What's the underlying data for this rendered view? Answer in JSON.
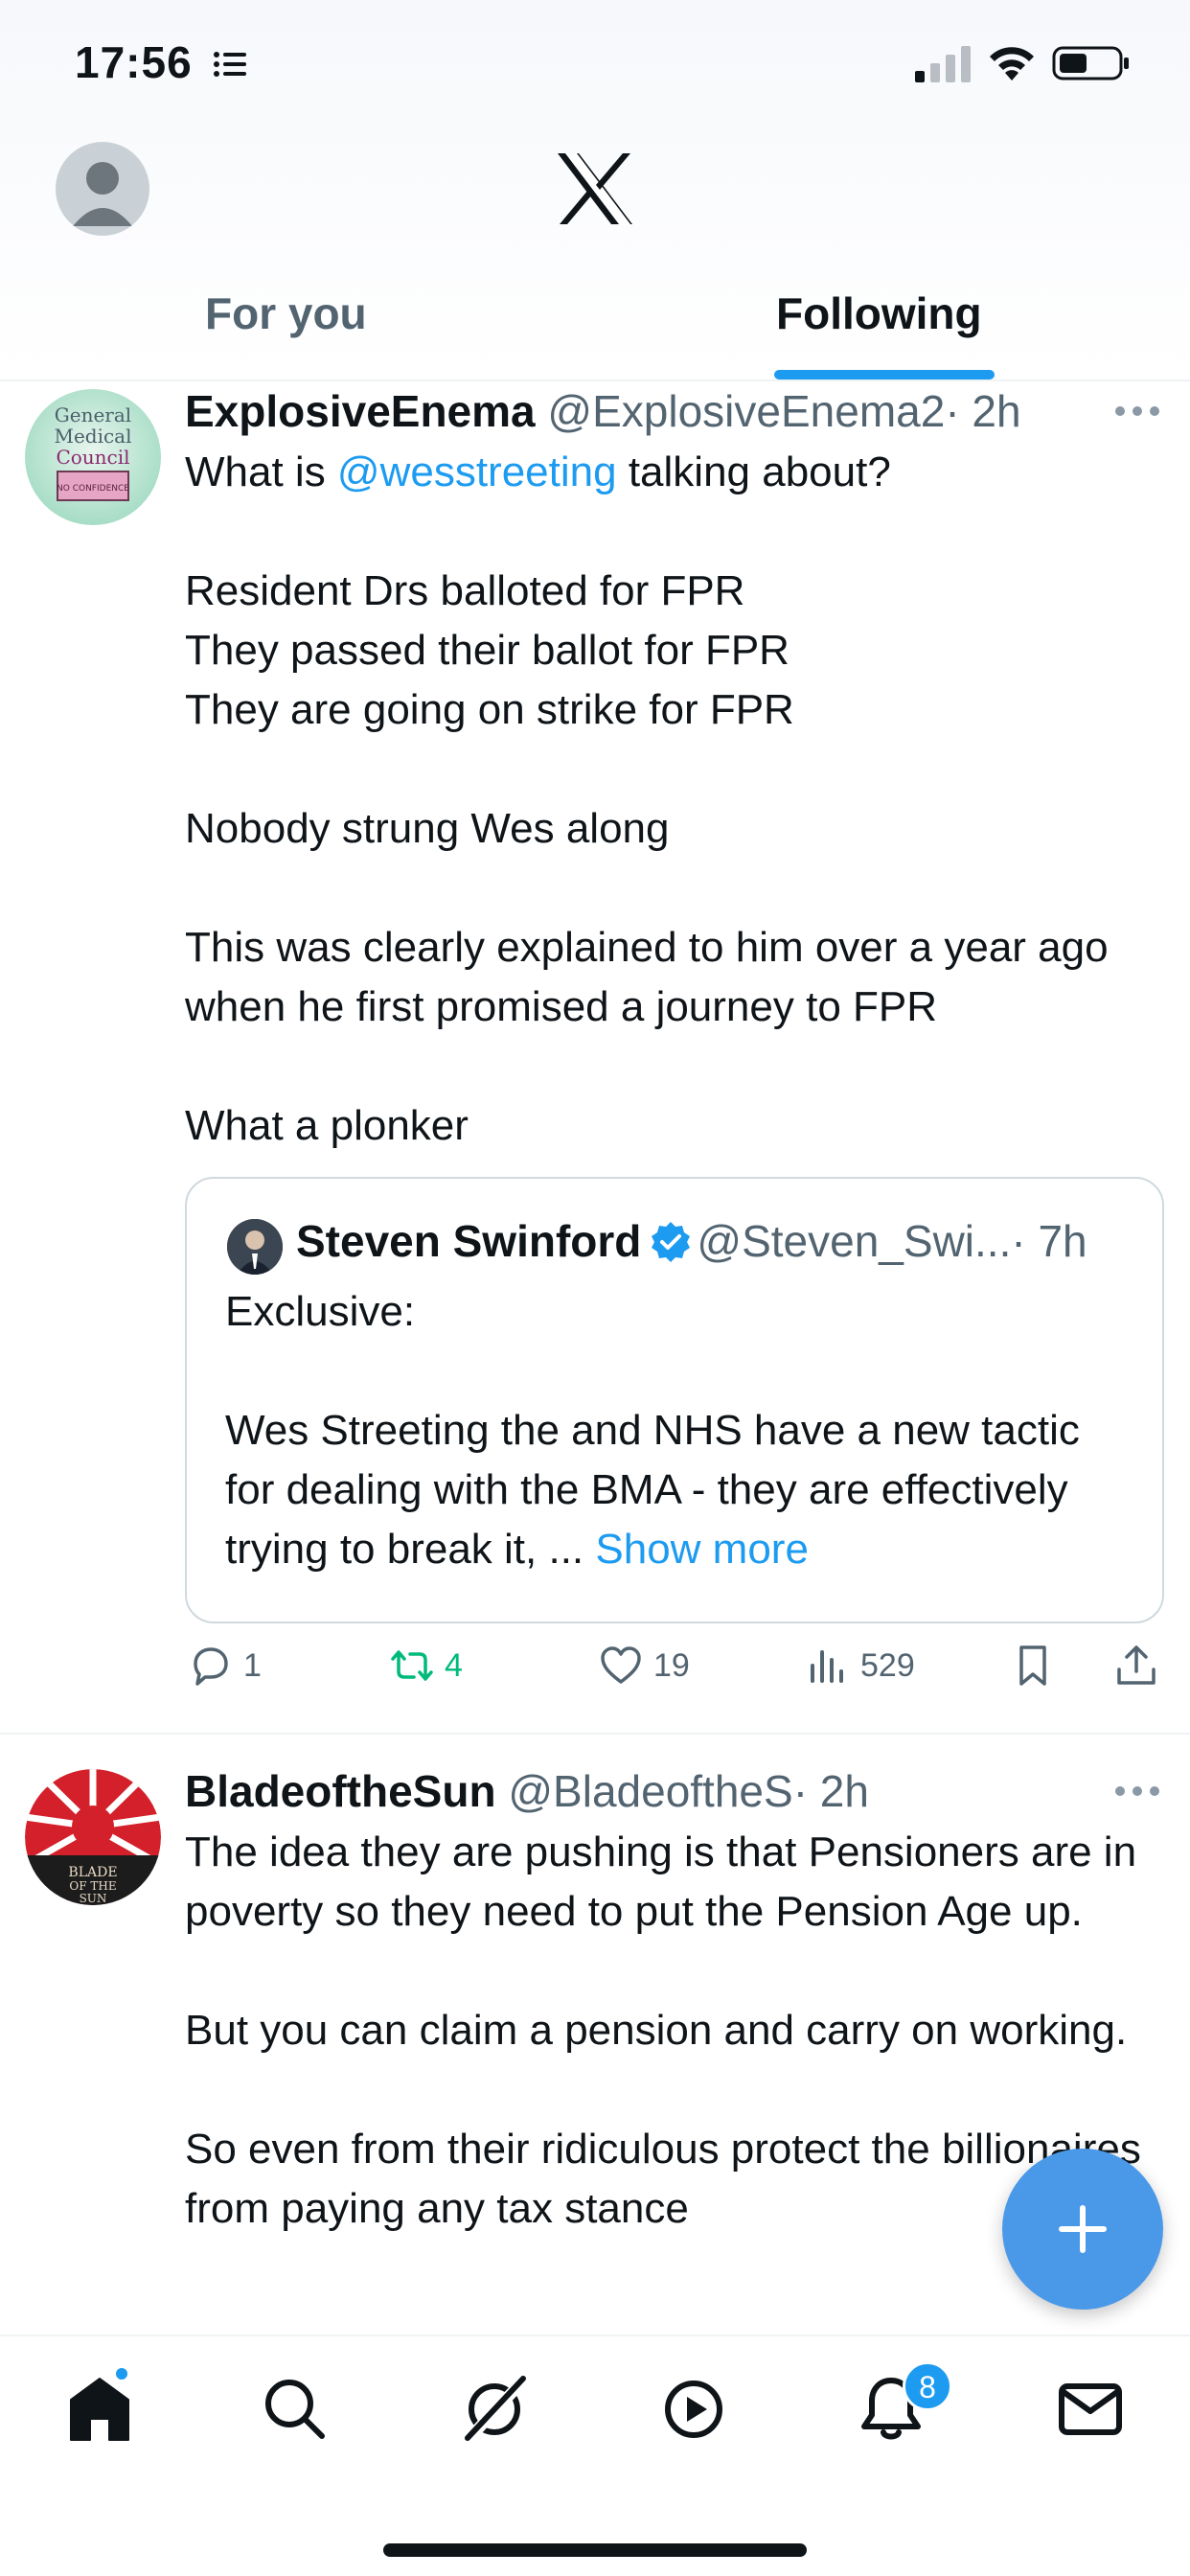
{
  "status_bar": {
    "time": "17:56"
  },
  "header": {
    "tabs": [
      {
        "label": "For you"
      },
      {
        "label": "Following"
      }
    ]
  },
  "posts": [
    {
      "name": "ExplosiveEnema",
      "handle": "@ExplosiveEnema2",
      "time": "· 2h",
      "text_prefix": "What is ",
      "mention": "@wesstreeting",
      "text_suffix": " talking about?\n\nResident Drs balloted for FPR\nThey passed their ballot for FPR\nThey are going on strike for FPR\n\nNobody strung Wes along\n\nThis was clearly explained to him over a year ago when he first promised a journey to FPR\n\nWhat a plonker",
      "avatar_text": [
        "General",
        "Medical",
        "Council",
        "NO CONFIDENCE"
      ],
      "quote": {
        "name": "Steven Swinford",
        "handle": "@Steven_Swi...",
        "time": "· 7h",
        "text": "Exclusive:\n\nWes Streeting the and NHS have a new tactic for dealing with the BMA - they are effectively trying to break it, ... ",
        "show_more": "Show more"
      },
      "actions": {
        "replies": "1",
        "reposts": "4",
        "likes": "19",
        "views": "529"
      }
    },
    {
      "name": "BladeoftheSun",
      "handle": "@BladeoftheS",
      "time": "· 2h",
      "text": "The idea they are pushing is that Pensioners are in poverty so they need to put the Pension Age up.\n\nBut you can claim a pension and carry on working.\n\nSo even from their ridiculous protect the billionaires from paying any tax stance",
      "avatar_text": [
        "BLADE",
        "OF THE",
        "SUN"
      ]
    }
  ],
  "bottom_nav": {
    "notifications_badge": "8"
  },
  "colors": {
    "accent": "#1d9bf0",
    "repost_active": "#00ba7c",
    "fab": "#4a99e9",
    "muted_text": "#536471"
  }
}
